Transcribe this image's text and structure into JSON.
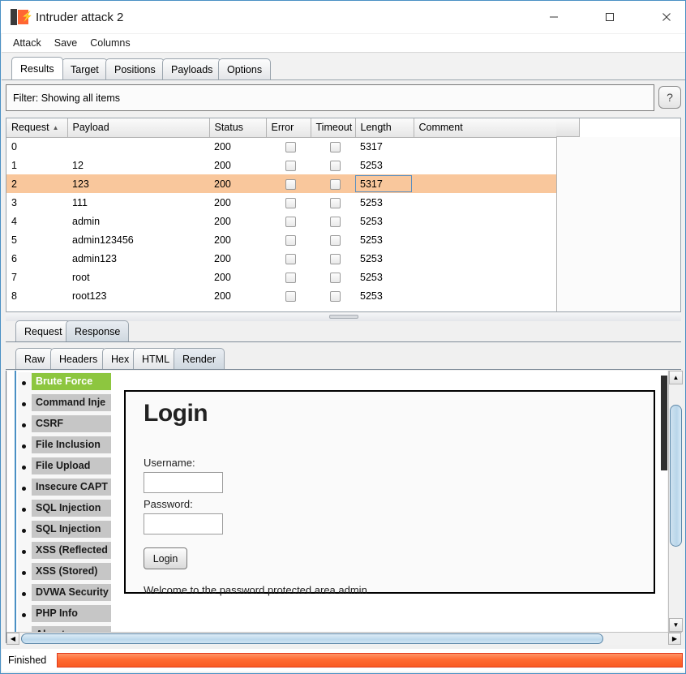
{
  "window": {
    "title": "Intruder attack 2",
    "icon": "burp-suite-icon",
    "controls": {
      "minimize": "minimize-icon",
      "maximize": "maximize-icon",
      "close": "close-icon"
    }
  },
  "menubar": {
    "items": [
      "Attack",
      "Save",
      "Columns"
    ]
  },
  "main_tabs": {
    "items": [
      "Results",
      "Target",
      "Positions",
      "Payloads",
      "Options"
    ],
    "active": "Results"
  },
  "filter": {
    "label": "Filter: Showing all items",
    "help": "?"
  },
  "results_table": {
    "columns": [
      "Request",
      "Payload",
      "Status",
      "Error",
      "Timeout",
      "Length",
      "Comment"
    ],
    "sort_column": "Request",
    "sort_direction": "ascending",
    "sort_arrow": "▲",
    "selected_row_index": 2,
    "rows": [
      {
        "request": "0",
        "payload": "",
        "status": "200",
        "error": false,
        "timeout": false,
        "length": "5317",
        "comment": ""
      },
      {
        "request": "1",
        "payload": "12",
        "status": "200",
        "error": false,
        "timeout": false,
        "length": "5253",
        "comment": ""
      },
      {
        "request": "2",
        "payload": "123",
        "status": "200",
        "error": false,
        "timeout": false,
        "length": "5317",
        "comment": ""
      },
      {
        "request": "3",
        "payload": "111",
        "status": "200",
        "error": false,
        "timeout": false,
        "length": "5253",
        "comment": ""
      },
      {
        "request": "4",
        "payload": "admin",
        "status": "200",
        "error": false,
        "timeout": false,
        "length": "5253",
        "comment": ""
      },
      {
        "request": "5",
        "payload": "admin123456",
        "status": "200",
        "error": false,
        "timeout": false,
        "length": "5253",
        "comment": ""
      },
      {
        "request": "6",
        "payload": "admin123",
        "status": "200",
        "error": false,
        "timeout": false,
        "length": "5253",
        "comment": ""
      },
      {
        "request": "7",
        "payload": "root",
        "status": "200",
        "error": false,
        "timeout": false,
        "length": "5253",
        "comment": ""
      },
      {
        "request": "8",
        "payload": "root123",
        "status": "200",
        "error": false,
        "timeout": false,
        "length": "5253",
        "comment": ""
      }
    ]
  },
  "message_tabs": {
    "items": [
      "Request",
      "Response"
    ],
    "active": "Response"
  },
  "view_tabs": {
    "items": [
      "Raw",
      "Headers",
      "Hex",
      "HTML",
      "Render"
    ],
    "active": "Render"
  },
  "rendered_page": {
    "menu": {
      "items": [
        "Brute Force",
        "Command Inje",
        "CSRF",
        "File Inclusion",
        "File Upload",
        "Insecure CAPT",
        "SQL Injection",
        "SQL Injection ",
        "XSS (Reflected",
        "XSS (Stored)",
        "DVWA Security",
        "PHP Info",
        "About"
      ],
      "active": "Brute Force",
      "active_color": "#8dc63f"
    },
    "login": {
      "heading": "Login",
      "username_label": "Username:",
      "username_value": "",
      "password_label": "Password:",
      "password_value": "",
      "submit_label": "Login",
      "message": "Welcome to the password protected area admin"
    }
  },
  "scrollbars": {
    "vertical_up": "▲",
    "vertical_down": "▼",
    "horizontal_left": "◀",
    "horizontal_right": "▶"
  },
  "statusbar": {
    "label": "Finished",
    "progress_percent": 100,
    "progress_color": "#ff6a33"
  }
}
